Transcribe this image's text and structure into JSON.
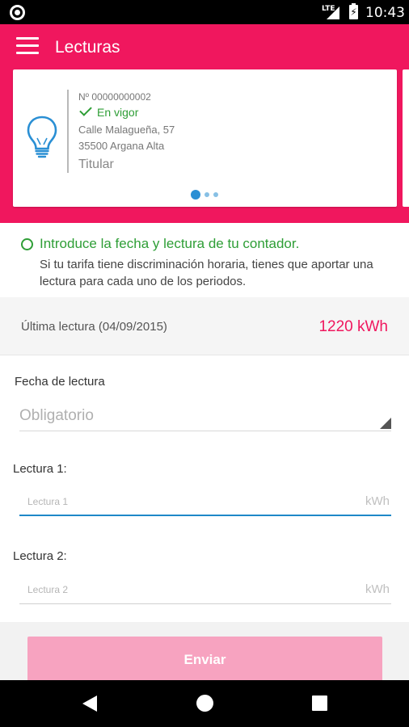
{
  "status_bar": {
    "network": "LTE",
    "time": "10:43",
    "icons": [
      "circle-app-icon",
      "signal-icon",
      "battery-charging-icon"
    ]
  },
  "app_bar": {
    "title": "Lecturas",
    "menu_icon": "hamburger-menu-icon",
    "color": "#f0175e"
  },
  "contract_card": {
    "icon": "lightbulb-icon",
    "number": "Nº 00000000002",
    "status": "En vigor",
    "address_line1": "Calle Malagueña, 57",
    "address_line2": "35500 Argana Alta",
    "role": "Titular",
    "pager_total": 3,
    "pager_active": 1
  },
  "intro": {
    "title": "Introduce la fecha y lectura de tu contador.",
    "body": "Si tu tarifa tiene discriminación horaria, tienes que aportar una lectura para cada uno de los periodos."
  },
  "last_reading": {
    "label": "Última lectura (04/09/2015)",
    "value": "1220 kWh"
  },
  "form": {
    "date_label": "Fecha de lectura",
    "date_placeholder": "Obligatorio",
    "reading1_label": "Lectura 1:",
    "reading1_placeholder": "Lectura 1",
    "reading1_unit": "kWh",
    "reading2_label": "Lectura 2:",
    "reading2_placeholder": "Lectura 2",
    "reading2_unit": "kWh",
    "submit_label": "Enviar"
  },
  "nav_bar": {
    "icons": [
      "back-icon",
      "home-icon",
      "recents-icon"
    ]
  }
}
